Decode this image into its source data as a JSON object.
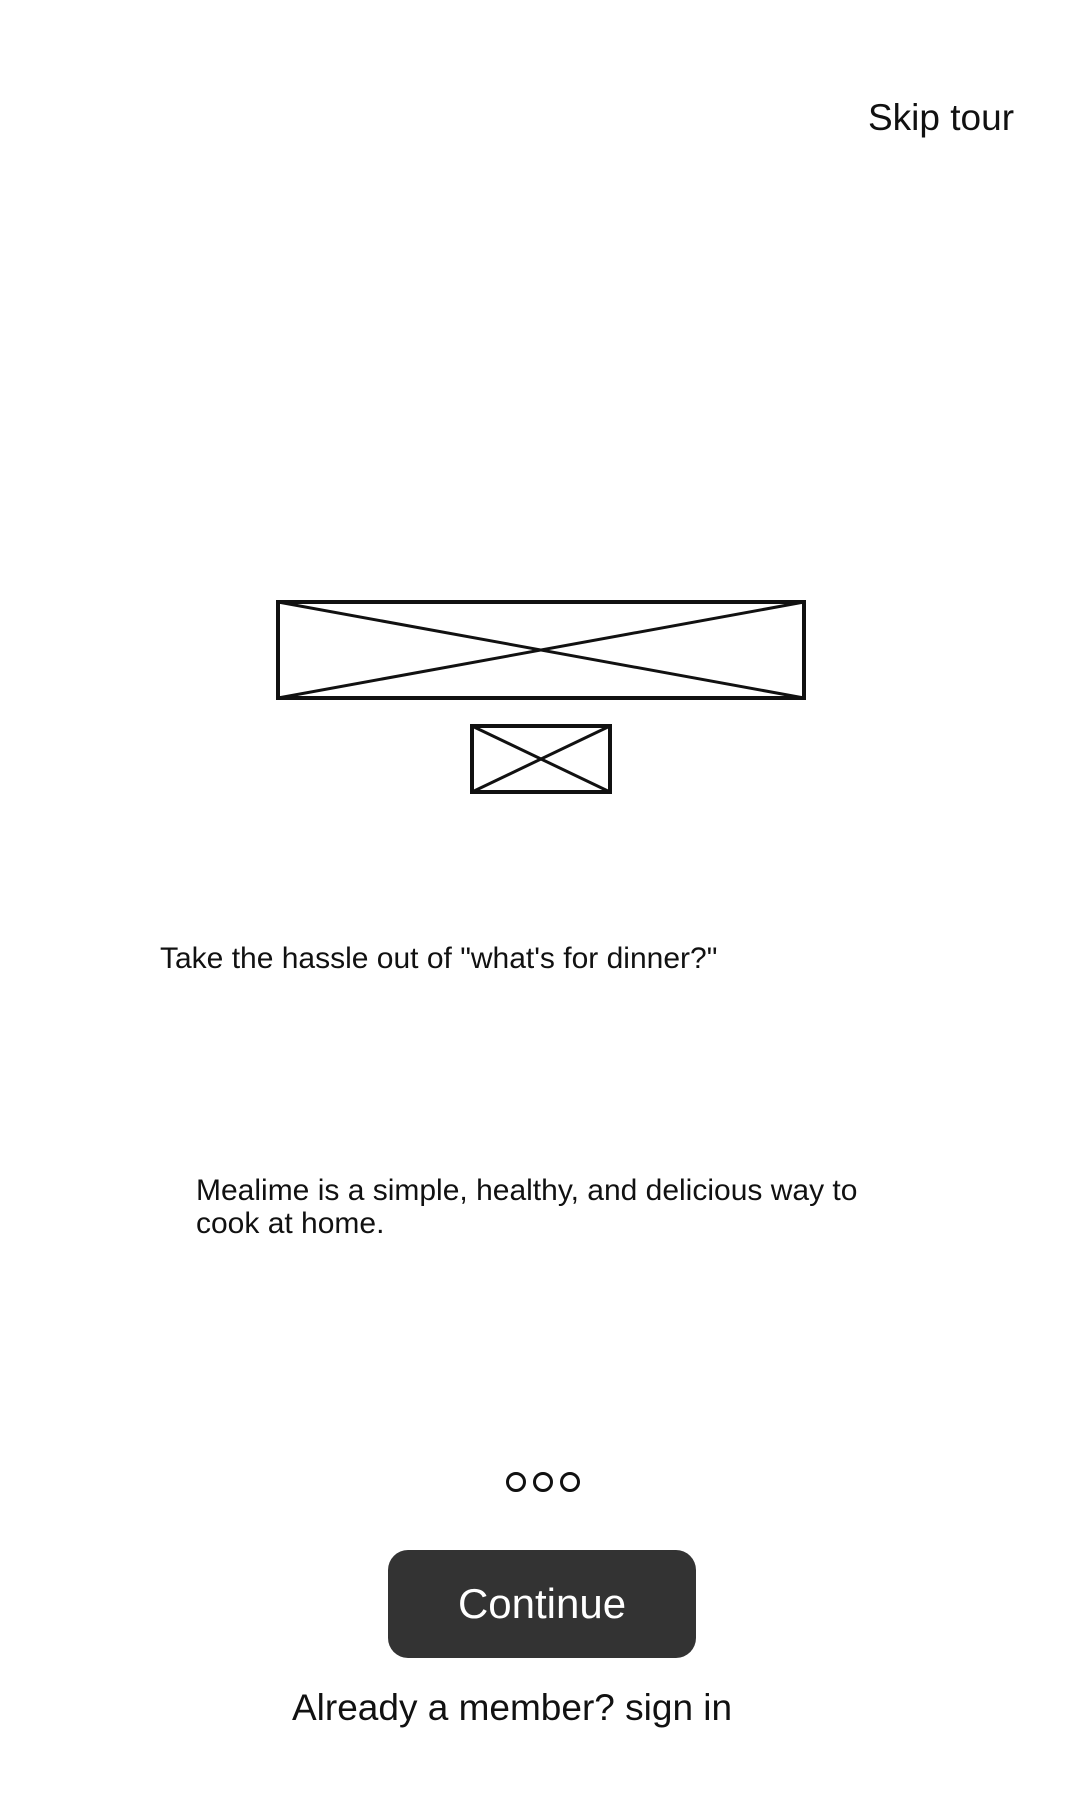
{
  "header": {
    "skip_tour_label": "Skip tour"
  },
  "hero": {
    "banner_image": "image-placeholder",
    "logo_image": "image-placeholder"
  },
  "content": {
    "headline": "Take the hassle out of \"what's for dinner?\"",
    "description": "Mealime is a simple, healthy, and delicious way to cook at home."
  },
  "pager": {
    "page_count": 3
  },
  "actions": {
    "continue_label": "Continue",
    "sign_in_label": "Already a member? sign in"
  },
  "colors": {
    "background": "#ffffff",
    "text": "#111111",
    "button_background": "#333333",
    "button_text": "#ffffff"
  }
}
